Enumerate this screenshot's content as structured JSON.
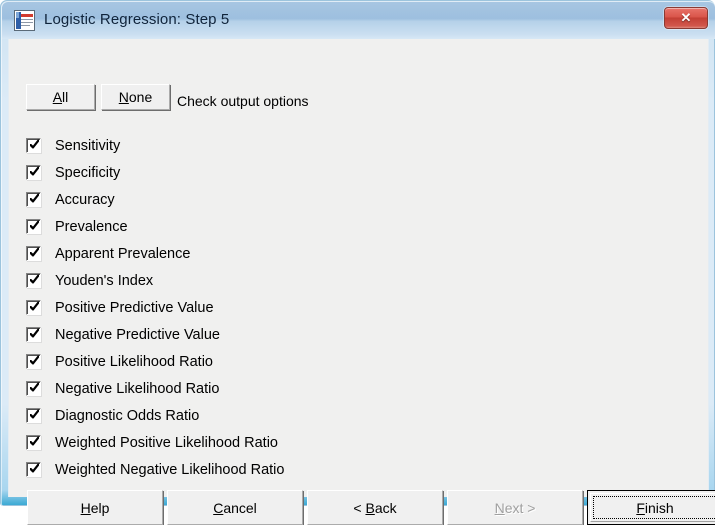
{
  "window": {
    "title": "Logistic Regression: Step 5",
    "icon": "document-chart-icon",
    "close_label": "✕",
    "accent_title_bg": "#9dbfdf",
    "close_button_color": "#c33f35",
    "client_bg": "#f0f0ef"
  },
  "toolbar": {
    "all_label": "All",
    "all_accel": "A",
    "none_label": "None",
    "none_accel": "N",
    "instruction": "Check output options"
  },
  "options": [
    {
      "label": "Sensitivity",
      "checked": true
    },
    {
      "label": "Specificity",
      "checked": true
    },
    {
      "label": "Accuracy",
      "checked": true
    },
    {
      "label": "Prevalence",
      "checked": true
    },
    {
      "label": "Apparent Prevalence",
      "checked": true
    },
    {
      "label": "Youden's Index",
      "checked": true
    },
    {
      "label": "Positive Predictive Value",
      "checked": true
    },
    {
      "label": "Negative Predictive Value",
      "checked": true
    },
    {
      "label": "Positive Likelihood Ratio",
      "checked": true
    },
    {
      "label": "Negative Likelihood Ratio",
      "checked": true
    },
    {
      "label": "Diagnostic Odds Ratio",
      "checked": true
    },
    {
      "label": "Weighted Positive Likelihood Ratio",
      "checked": true
    },
    {
      "label": "Weighted Negative Likelihood Ratio",
      "checked": true
    }
  ],
  "buttons": {
    "help": {
      "label": "Help",
      "accel": "H",
      "disabled": false,
      "default": false
    },
    "cancel": {
      "label": "Cancel",
      "accel": "C",
      "disabled": false,
      "default": false
    },
    "back": {
      "label": "< Back",
      "accel": "B",
      "disabled": false,
      "default": false
    },
    "next": {
      "label": "Next >",
      "accel": "N",
      "disabled": true,
      "default": false
    },
    "finish": {
      "label": "Finish",
      "accel": "F",
      "disabled": false,
      "default": true
    }
  }
}
